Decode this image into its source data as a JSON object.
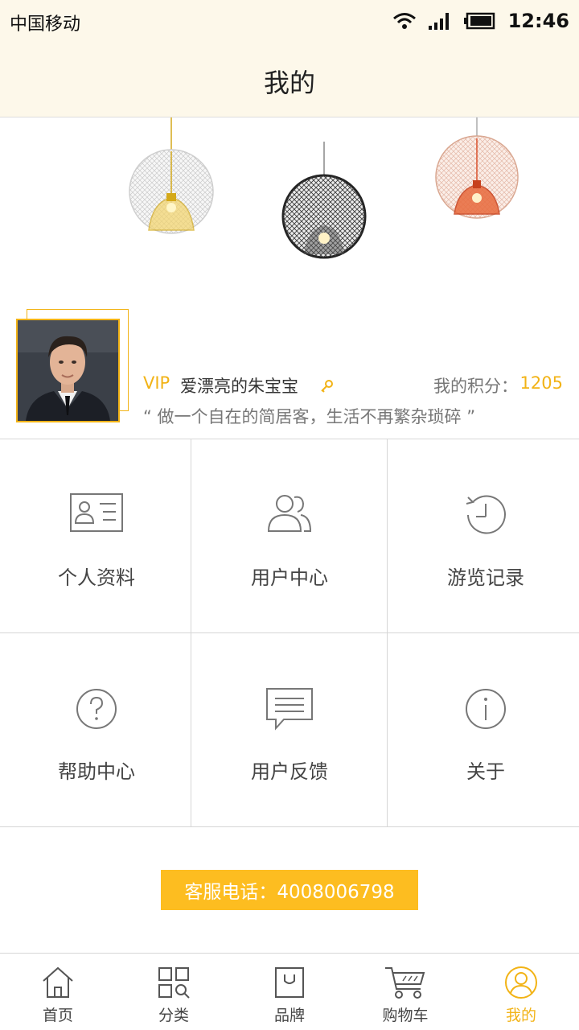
{
  "status_bar": {
    "carrier": "中国移动",
    "time": "12:46"
  },
  "header": {
    "title": "我的"
  },
  "profile": {
    "vip_label": "VIP",
    "username": "爱漂亮的朱宝宝",
    "points_label": "我的积分：",
    "points_value": "1205",
    "motto": "“ 做一个自在的简居客，生活不再繁杂琐碎 ”"
  },
  "menu": [
    {
      "label": "个人资料",
      "icon": "id-card-icon"
    },
    {
      "label": "用户中心",
      "icon": "users-icon"
    },
    {
      "label": "游览记录",
      "icon": "history-icon"
    },
    {
      "label": "帮助中心",
      "icon": "help-icon"
    },
    {
      "label": "用户反馈",
      "icon": "feedback-icon"
    },
    {
      "label": "关于",
      "icon": "info-icon"
    }
  ],
  "service": {
    "text": "客服电话：4008006798"
  },
  "tabs": [
    {
      "label": "首页",
      "icon": "home-icon"
    },
    {
      "label": "分类",
      "icon": "category-icon"
    },
    {
      "label": "品牌",
      "icon": "brand-bag-icon"
    },
    {
      "label": "购物车",
      "icon": "cart-icon"
    },
    {
      "label": "我的",
      "icon": "user-icon",
      "active": true
    }
  ],
  "colors": {
    "accent": "#f2b316",
    "service_bg": "#fdbd20",
    "header_bg": "#fdf8ea"
  }
}
